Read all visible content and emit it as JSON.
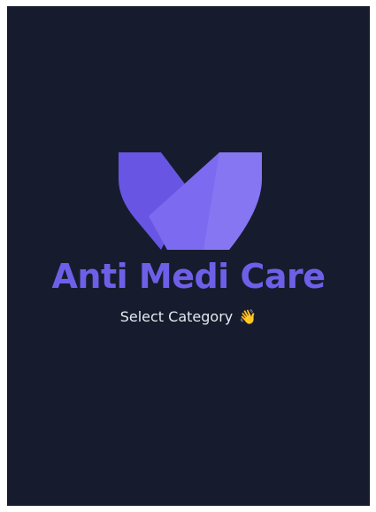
{
  "app": {
    "title": "Anti Medi Care",
    "subtitle": "Select Category",
    "subtitle_icon": "waving-hand-icon",
    "subtitle_emoji": "👋"
  },
  "colors": {
    "background": "#161c2e",
    "accent": "#6f5fe8",
    "logo_dark": "#6955e4",
    "logo_light": "#8f80f2",
    "subtitle_text": "#e6e8ee"
  },
  "icons": {
    "logo": "v-shape-logo-icon"
  }
}
